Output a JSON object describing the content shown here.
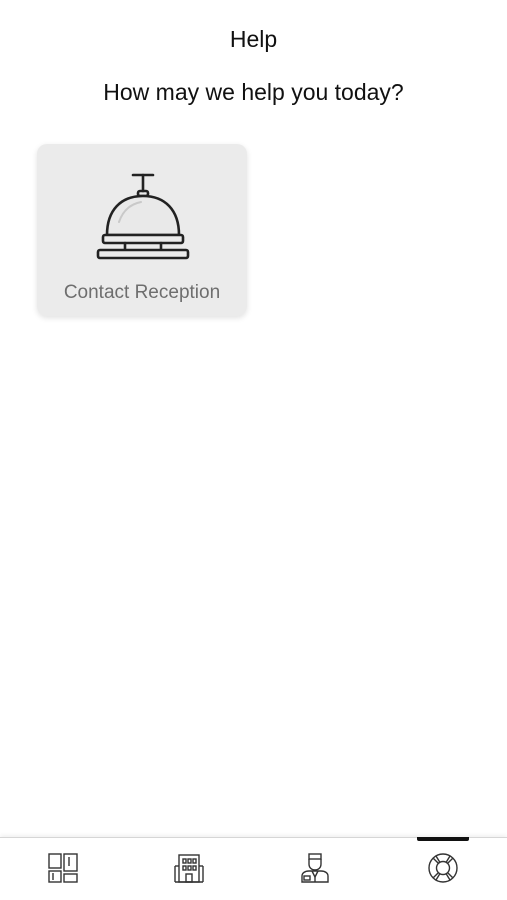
{
  "header": {
    "title": "Help"
  },
  "main": {
    "prompt": "How may we help you today?",
    "cards": [
      {
        "label": "Contact Reception",
        "icon": "service-bell-icon"
      }
    ]
  },
  "tabbar": {
    "active_tab": "help",
    "tabs": [
      {
        "id": "dashboard",
        "icon": "dashboard-icon"
      },
      {
        "id": "hotel",
        "icon": "hotel-building-icon"
      },
      {
        "id": "concierge",
        "icon": "concierge-staff-icon"
      },
      {
        "id": "help",
        "icon": "lifebuoy-icon"
      }
    ]
  },
  "colors": {
    "card_background": "#ebebeb",
    "card_label": "#6e6e6e",
    "active_indicator": "#111111"
  }
}
